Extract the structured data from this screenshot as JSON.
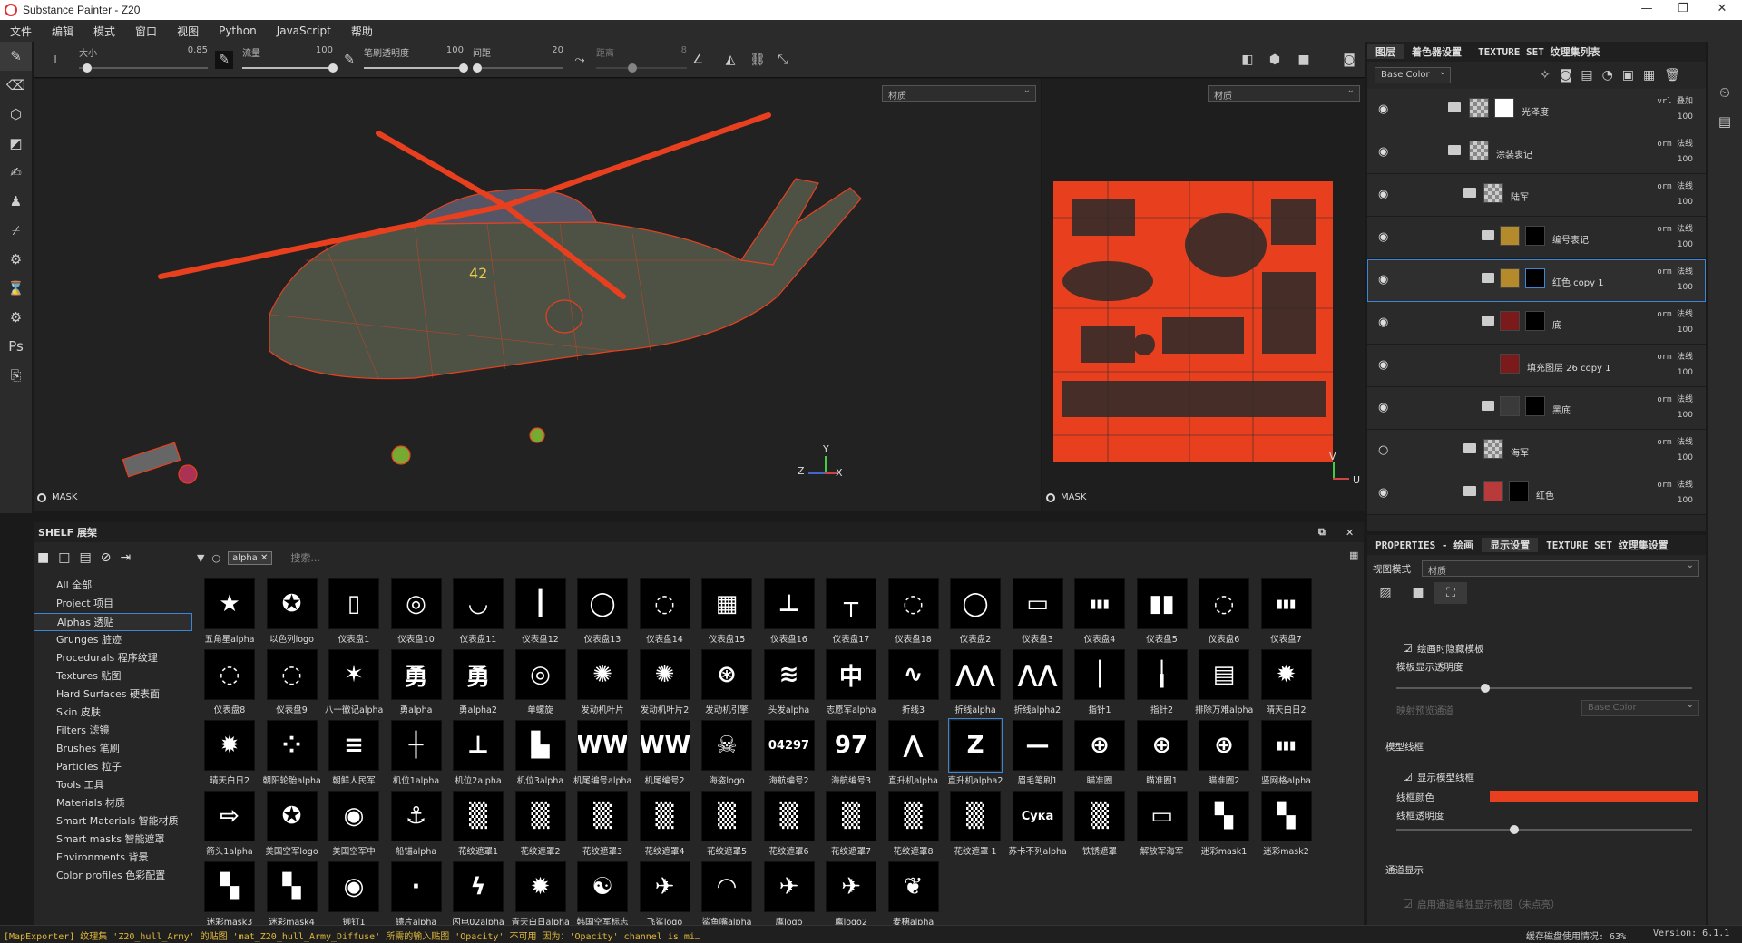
{
  "window": {
    "title": "Substance Painter - Z20"
  },
  "menu": [
    "文件",
    "编辑",
    "模式",
    "窗口",
    "视图",
    "Python",
    "JavaScript",
    "帮助"
  ],
  "toolbar": {
    "size": {
      "label": "大小",
      "value": "0.85"
    },
    "flow": {
      "label": "流量",
      "value": "100"
    },
    "opacity": {
      "label": "笔刷透明度",
      "value": "100"
    },
    "spacing": {
      "label": "间距",
      "value": "20"
    },
    "jitter": {
      "label": "距离",
      "value": "8"
    }
  },
  "viewport3d": {
    "material_dropdown": "材质",
    "mask_label": "MASK",
    "axes": [
      "Y",
      "Z",
      "X"
    ]
  },
  "viewport2d": {
    "material_dropdown": "材质",
    "mask_label": "MASK",
    "axes": [
      "V",
      "U"
    ]
  },
  "layers_panel": {
    "tabs": [
      "图层",
      "着色器设置",
      "TEXTURE SET 纹理集列表"
    ],
    "channel_select": "Base Color",
    "layers": [
      {
        "name": "光泽度",
        "blend": "vrl 叠加",
        "opacity": "100",
        "depth": 2
      },
      {
        "name": "涂装衷记",
        "blend": "orm 法线",
        "opacity": "100",
        "depth": 1
      },
      {
        "name": "陆军",
        "blend": "orm 法线",
        "opacity": "100",
        "depth": 2
      },
      {
        "name": "编号衷记",
        "blend": "orm 法线",
        "opacity": "100",
        "depth": 3
      },
      {
        "name": "红色 copy 1",
        "blend": "orm 法线",
        "opacity": "100",
        "depth": 3,
        "selected": true
      },
      {
        "name": "底",
        "blend": "orm 法线",
        "opacity": "100",
        "depth": 3
      },
      {
        "name": "填充图层 26 copy 1",
        "blend": "orm 法线",
        "opacity": "100",
        "depth": 4
      },
      {
        "name": "黑底",
        "blend": "orm 法线",
        "opacity": "100",
        "depth": 3
      },
      {
        "name": "海军",
        "blend": "orm 法线",
        "opacity": "100",
        "depth": 2
      },
      {
        "name": "红色",
        "blend": "orm 法线",
        "opacity": "100",
        "depth": 2
      }
    ]
  },
  "shelf": {
    "title": "SHELF 展架",
    "filter_tag": "alpha",
    "search_placeholder": "搜索...",
    "categories": [
      "All 全部",
      "Project 项目",
      "Alphas 透贴",
      "Grunges 脏迹",
      "Procedurals 程序纹理",
      "Textures 贴图",
      "Hard Surfaces 硬表面",
      "Skin 皮肤",
      "Filters 滤镜",
      "Brushes 笔刷",
      "Particles 粒子",
      "Tools 工具",
      "Materials 材质",
      "Smart Materials 智能材质",
      "Smart masks 智能遮罩",
      "Environments 背景",
      "Color profiles 色彩配置"
    ],
    "active_category": "Alphas 透贴",
    "items": [
      {
        "cap": "五角星alpha",
        "g": "★"
      },
      {
        "cap": "以色列logo",
        "g": "✪"
      },
      {
        "cap": "仪表盘1",
        "g": "▯"
      },
      {
        "cap": "仪表盘10",
        "g": "◎"
      },
      {
        "cap": "仪表盘11",
        "g": "◡"
      },
      {
        "cap": "仪表盘12",
        "g": "┃"
      },
      {
        "cap": "仪表盘13",
        "g": "◯"
      },
      {
        "cap": "仪表盘14",
        "g": "◌"
      },
      {
        "cap": "仪表盘15",
        "g": "▦"
      },
      {
        "cap": "仪表盘16",
        "g": "⊥"
      },
      {
        "cap": "仪表盘17",
        "g": "┬"
      },
      {
        "cap": "仪表盘18",
        "g": "◌"
      },
      {
        "cap": "仪表盘2",
        "g": "◯"
      },
      {
        "cap": "仪表盘3",
        "g": "▭"
      },
      {
        "cap": "仪表盘4",
        "g": "▮▮▮"
      },
      {
        "cap": "仪表盘5",
        "g": "▮▮"
      },
      {
        "cap": "仪表盘6",
        "g": "◌"
      },
      {
        "cap": "仪表盘7",
        "g": "▮▮▮"
      },
      {
        "cap": "仪表盘8",
        "g": "◌"
      },
      {
        "cap": "仪表盘9",
        "g": "◌"
      },
      {
        "cap": "八一徽记alpha",
        "g": "✶"
      },
      {
        "cap": "勇alpha",
        "g": "勇"
      },
      {
        "cap": "勇alpha2",
        "g": "勇"
      },
      {
        "cap": "单螺旋",
        "g": "◎"
      },
      {
        "cap": "发动机叶片",
        "g": "✺"
      },
      {
        "cap": "发动机叶片2",
        "g": "✺"
      },
      {
        "cap": "发动机引擎",
        "g": "⊛"
      },
      {
        "cap": "头发alpha",
        "g": "≋"
      },
      {
        "cap": "志愿军alpha",
        "g": "中"
      },
      {
        "cap": "折线3",
        "g": "∿"
      },
      {
        "cap": "折线alpha",
        "g": "⋀⋀"
      },
      {
        "cap": "折线alpha2",
        "g": "⋀⋀"
      },
      {
        "cap": "指针1",
        "g": "│"
      },
      {
        "cap": "指针2",
        "g": "╽"
      },
      {
        "cap": "排除万难alpha",
        "g": "▤"
      },
      {
        "cap": "晴天白日2",
        "g": "✹"
      },
      {
        "cap": "晴天白日2",
        "g": "✹"
      },
      {
        "cap": "朝阳轮胎alpha",
        "g": "⁘"
      },
      {
        "cap": "朝鲜人民军",
        "g": "≡"
      },
      {
        "cap": "机位1alpha",
        "g": "┼"
      },
      {
        "cap": "机位2alpha",
        "g": "⊥"
      },
      {
        "cap": "机位3alpha",
        "g": "▙"
      },
      {
        "cap": "机尾编号alpha",
        "g": "WW"
      },
      {
        "cap": "机尾编号2",
        "g": "WW"
      },
      {
        "cap": "海盗logo",
        "g": "☠"
      },
      {
        "cap": "海航编号2",
        "g": "04297"
      },
      {
        "cap": "海航编号3",
        "g": "97"
      },
      {
        "cap": "直升机alpha",
        "g": "⋀"
      },
      {
        "cap": "直升机alpha2",
        "g": "Z"
      },
      {
        "cap": "眉毛笔刷1",
        "g": "—"
      },
      {
        "cap": "瞄准圈",
        "g": "⊕"
      },
      {
        "cap": "瞄准圈1",
        "g": "⊕"
      },
      {
        "cap": "瞄准圈2",
        "g": "⊕"
      },
      {
        "cap": "竖网格alpha",
        "g": "▮▮▮"
      },
      {
        "cap": "箭头1alpha",
        "g": "⇨"
      },
      {
        "cap": "美国空军logo",
        "g": "✪"
      },
      {
        "cap": "美国空军中",
        "g": "◉"
      },
      {
        "cap": "船锚alpha",
        "g": "⚓"
      },
      {
        "cap": "花纹遮罩1",
        "g": "▒"
      },
      {
        "cap": "花纹遮罩2",
        "g": "▒"
      },
      {
        "cap": "花纹遮罩3",
        "g": "▒"
      },
      {
        "cap": "花纹遮罩4",
        "g": "▒"
      },
      {
        "cap": "花纹遮罩5",
        "g": "▒"
      },
      {
        "cap": "花纹遮罩6",
        "g": "▒"
      },
      {
        "cap": "花纹遮罩7",
        "g": "▒"
      },
      {
        "cap": "花纹遮罩8",
        "g": "▒"
      },
      {
        "cap": "花纹遮罩 1",
        "g": "▒"
      },
      {
        "cap": "苏卡不列alpha",
        "g": "Сука"
      },
      {
        "cap": "铁锈遮罩",
        "g": "▒"
      },
      {
        "cap": "解放军海军",
        "g": "▭"
      },
      {
        "cap": "迷彩mask1",
        "g": "▚"
      },
      {
        "cap": "迷彩mask2",
        "g": "▚"
      },
      {
        "cap": "迷彩mask3",
        "g": "▚"
      },
      {
        "cap": "迷彩mask4",
        "g": "▚"
      },
      {
        "cap": "铆钉1",
        "g": "◉"
      },
      {
        "cap": "镜片alpha",
        "g": "·"
      },
      {
        "cap": "闪电02alpha",
        "g": "ϟ"
      },
      {
        "cap": "青天白日alpha",
        "g": "✹"
      },
      {
        "cap": "韩国空军标志",
        "g": "☯"
      },
      {
        "cap": "飞鲨logo",
        "g": "✈"
      },
      {
        "cap": "鲨鱼嘴alpha",
        "g": "◠"
      },
      {
        "cap": "鹰logo",
        "g": "✈"
      },
      {
        "cap": "鹰logo2",
        "g": "✈"
      },
      {
        "cap": "麦穗alpha",
        "g": "❦"
      }
    ],
    "selected_item": "直升机alpha2"
  },
  "properties": {
    "tabs": [
      "PROPERTIES - 绘画",
      "显示设置",
      "TEXTURE SET 纹理集设置"
    ],
    "view_mode_label": "视图模式",
    "view_mode_value": "材质",
    "hide_while_painting": "绘画时隐藏模板",
    "template_opacity": "模板显示透明度",
    "map_preview": "映射预览通道",
    "map_preview_value": "Base Color",
    "wireframe_section": "模型线框",
    "show_wireframe": "显示模型线框",
    "wire_color_label": "线框颜色",
    "wire_color": "#e8401f",
    "wire_opacity_label": "线框透明度",
    "channel_display": "通道显示",
    "isolate_label": "启用通道单独显示视图（未点亮）"
  },
  "status": {
    "message": "[MapExporter] 纹理集 'Z20_hull_Army' 的贴图 'mat_Z20_hull_Army_Diffuse' 所需的输入贴图 'Opacity' 不可用 因为：'Opacity' channel is mi…",
    "cache": "缓存磁盘使用情况: 63%",
    "version": "Version: 6.1.1"
  }
}
